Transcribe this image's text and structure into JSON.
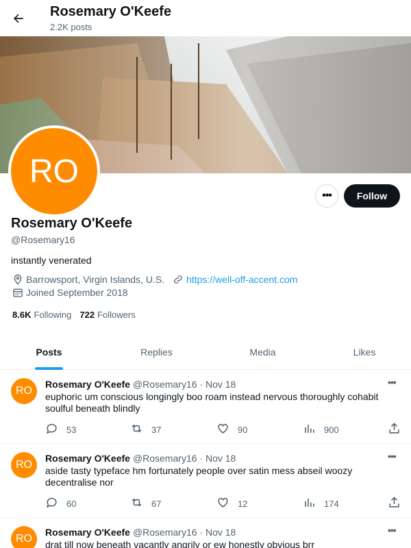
{
  "header": {
    "title": "Rosemary O'Keefe",
    "subtitle": "2.2K posts"
  },
  "profile": {
    "avatar_initials": "RO",
    "avatar_color": "#ff8c00",
    "name": "Rosemary O'Keefe",
    "handle": "@Rosemary16",
    "bio": "instantly venerated",
    "location": "Barrowsport, Virgin Islands, U.S.",
    "website": "https://well-off-accent.com",
    "joined": "Joined September 2018",
    "following_count": "8.6K",
    "following_label": "Following",
    "followers_count": "722",
    "followers_label": "Followers",
    "follow_label": "Follow",
    "more_label": "•••"
  },
  "tabs": [
    {
      "label": "Posts",
      "active": true
    },
    {
      "label": "Replies",
      "active": false
    },
    {
      "label": "Media",
      "active": false
    },
    {
      "label": "Likes",
      "active": false
    }
  ],
  "posts": [
    {
      "initials": "RO",
      "name": "Rosemary O'Keefe",
      "meta": "@Rosemary16 · Nov 18",
      "text": "euphoric um conscious longingly boo roam instead nervous thoroughly cohabit soulful beneath blindly",
      "replies": "53",
      "reposts": "37",
      "likes": "90",
      "views": "900"
    },
    {
      "initials": "RO",
      "name": "Rosemary O'Keefe",
      "meta": "@Rosemary16 · Nov 18",
      "text": "aside tasty typeface hm fortunately people over satin mess abseil woozy decentralise nor",
      "replies": "60",
      "reposts": "67",
      "likes": "12",
      "views": "174"
    },
    {
      "initials": "RO",
      "name": "Rosemary O'Keefe",
      "meta": "@Rosemary16 · Nov 18",
      "text": "drat till now beneath vacantly angrily or ew honestly obvious brr"
    }
  ],
  "colors": {
    "accent": "#1d9bf0",
    "text": "#0f1419",
    "muted": "#536471"
  }
}
